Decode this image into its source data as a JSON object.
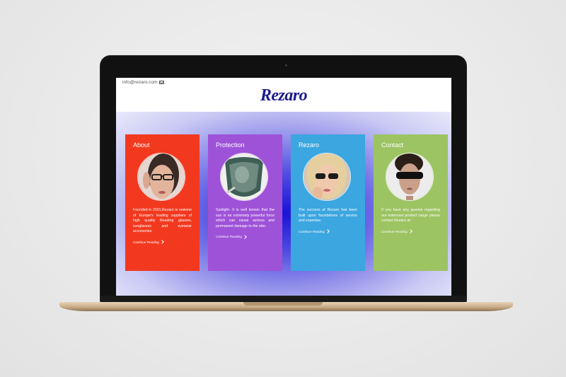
{
  "header": {
    "email": "info@rezaro.com",
    "logo_text": "Rezaro"
  },
  "cards": [
    {
      "title": "About",
      "text": "Founded in 2001,Rezaro is nowone of Europe's leading suppliers of high quality Reading glasses, sunglasses and eyewear accrssories.",
      "link": "Continue Reading",
      "color": "#f2391f"
    },
    {
      "title": "Protection",
      "text": "Sunlight- It is well known that the sun is an extremely powerful force which can cause serious and permanent damage to the skin.",
      "link": "Continue Reading",
      "color": "#9e52d8"
    },
    {
      "title": "Rezaro",
      "text": "The success of Rezaro has been built upon foundations of service and expertise.",
      "link": "Continue Reading",
      "color": "#3ba6e0"
    },
    {
      "title": "Contact",
      "text": "If you have any queries regarding our extensive product range please contact Rezaro at:",
      "link": "Continue Reading",
      "color": "#9cc463"
    }
  ]
}
